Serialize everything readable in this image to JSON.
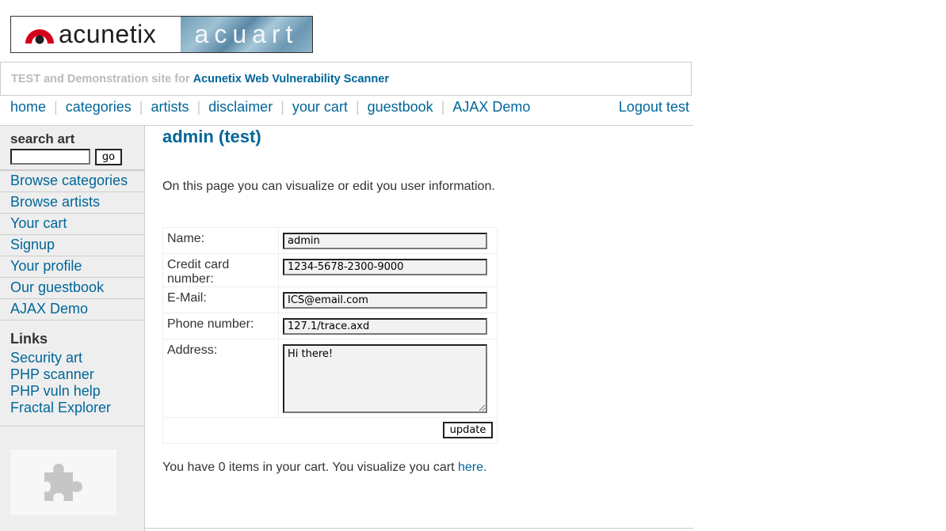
{
  "logo": {
    "left_word": "acunetix",
    "right_word": "acuart"
  },
  "header": {
    "prefix": "TEST and Demonstration site for ",
    "product": "Acunetix Web Vulnerability Scanner"
  },
  "nav": {
    "items": [
      "home",
      "categories",
      "artists",
      "disclaimer",
      "your cart",
      "guestbook",
      "AJAX Demo"
    ],
    "separator": "|",
    "logout": "Logout test"
  },
  "sidebar": {
    "search_label": "search art",
    "search_value": "",
    "go_label": "go",
    "menu": [
      "Browse categories",
      "Browse artists",
      "Your cart",
      "Signup",
      "Your profile",
      "Our guestbook",
      "AJAX Demo"
    ],
    "links_title": "Links",
    "links": [
      "Security art",
      "PHP scanner",
      "PHP vuln help",
      "Fractal Explorer"
    ],
    "puzzle_icon": "puzzle-icon"
  },
  "main": {
    "title": "admin (test)",
    "intro": "On this page you can visualize or edit you user information.",
    "form": {
      "name_label": "Name:",
      "name_value": "admin",
      "cc_label": "Credit card number:",
      "cc_value": "1234-5678-2300-9000",
      "email_label": "E-Mail:",
      "email_value": "ICS@email.com",
      "phone_label": "Phone number:",
      "phone_value": "127.1/trace.axd",
      "address_label": "Address:",
      "address_value": "Hi there!",
      "update_label": "update"
    },
    "cart_text": "You have 0 items in your cart. You visualize you cart ",
    "cart_link": "here."
  },
  "colors": {
    "link": "#006699",
    "sidebar_bg": "#eeeeee",
    "border": "#cccccc",
    "logo_red": "#d3001c"
  }
}
